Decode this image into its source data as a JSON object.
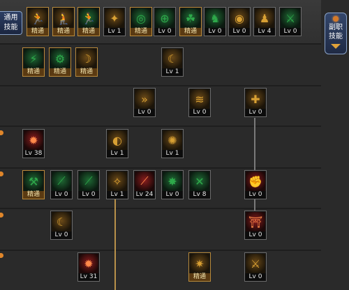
{
  "tabs": {
    "left_tab_label": "通用\n技能",
    "right_tab_label": "副职\n技能"
  },
  "colors": {
    "background": "#2a2a2a",
    "green_icon": "#2ea84a",
    "gold_icon": "#d8a033",
    "red_icon": "#c23030",
    "mastered_label": "#f4e6b0",
    "tree_line_gold": "#b8914a",
    "tree_line_gray": "#7a7a7a"
  },
  "skills": [
    {
      "name": "skill-1-1",
      "label": "精通",
      "glyph": "🏃",
      "theme": "gold",
      "mastered": true
    },
    {
      "name": "skill-1-2",
      "label": "精通",
      "glyph": "🧎",
      "theme": "gold",
      "mastered": true
    },
    {
      "name": "skill-1-3",
      "label": "精通",
      "glyph": "🏃",
      "theme": "green",
      "mastered": true
    },
    {
      "name": "skill-1-4",
      "label": "Lv 1",
      "glyph": "✦",
      "theme": "gold",
      "mastered": false
    },
    {
      "name": "skill-1-5",
      "label": "精通",
      "glyph": "◎",
      "theme": "green",
      "mastered": true
    },
    {
      "name": "skill-1-6",
      "label": "Lv 0",
      "glyph": "⊕",
      "theme": "green",
      "mastered": false
    },
    {
      "name": "skill-1-7",
      "label": "精通",
      "glyph": "☘",
      "theme": "green",
      "mastered": true
    },
    {
      "name": "skill-1-8",
      "label": "Lv 0",
      "glyph": "♞",
      "theme": "green",
      "mastered": false
    },
    {
      "name": "skill-1-9",
      "label": "Lv 0",
      "glyph": "◉",
      "theme": "gold",
      "mastered": false
    },
    {
      "name": "skill-1-10",
      "label": "Lv 4",
      "glyph": "♟",
      "theme": "gold",
      "mastered": false
    },
    {
      "name": "skill-1-11",
      "label": "Lv 0",
      "glyph": "⚔",
      "theme": "green",
      "mastered": false
    },
    {
      "name": "skill-2-1",
      "label": "精通",
      "glyph": "⚡",
      "theme": "green",
      "mastered": true
    },
    {
      "name": "skill-2-2",
      "label": "精通",
      "glyph": "⚙",
      "theme": "green",
      "mastered": true
    },
    {
      "name": "skill-2-3",
      "label": "精通",
      "glyph": "☽",
      "theme": "gold",
      "mastered": true
    },
    {
      "name": "skill-2-4",
      "label": "Lv 1",
      "glyph": "☾",
      "theme": "gold",
      "mastered": false
    },
    {
      "name": "skill-3-1",
      "label": "Lv 0",
      "glyph": "»",
      "theme": "gold",
      "mastered": false
    },
    {
      "name": "skill-3-2",
      "label": "Lv 0",
      "glyph": "≋",
      "theme": "gold",
      "mastered": false
    },
    {
      "name": "skill-3-3",
      "label": "Lv 0",
      "glyph": "✚",
      "theme": "gold",
      "mastered": false
    },
    {
      "name": "skill-4-1",
      "label": "Lv 38",
      "glyph": "✹",
      "theme": "red",
      "mastered": false
    },
    {
      "name": "skill-4-2",
      "label": "Lv 1",
      "glyph": "◐",
      "theme": "gold",
      "mastered": false
    },
    {
      "name": "skill-4-3",
      "label": "Lv 1",
      "glyph": "✺",
      "theme": "gold",
      "mastered": false
    },
    {
      "name": "skill-5-1",
      "label": "精通",
      "glyph": "⚒",
      "theme": "green",
      "mastered": true
    },
    {
      "name": "skill-5-2",
      "label": "Lv 0",
      "glyph": "⟋",
      "theme": "green",
      "mastered": false
    },
    {
      "name": "skill-5-3",
      "label": "Lv 0",
      "glyph": "⟋",
      "theme": "green",
      "mastered": false
    },
    {
      "name": "skill-5-4",
      "label": "Lv 1",
      "glyph": "✧",
      "theme": "gold",
      "mastered": false
    },
    {
      "name": "skill-5-5",
      "label": "Lv 24",
      "glyph": "⟋",
      "theme": "red",
      "mastered": false
    },
    {
      "name": "skill-5-6",
      "label": "Lv 0",
      "glyph": "✸",
      "theme": "green",
      "mastered": false
    },
    {
      "name": "skill-5-7",
      "label": "Lv 8",
      "glyph": "✕",
      "theme": "green",
      "mastered": false
    },
    {
      "name": "skill-5-8",
      "label": "Lv 0",
      "glyph": "✊",
      "theme": "red",
      "mastered": false
    },
    {
      "name": "skill-6-1",
      "label": "Lv 0",
      "glyph": "☾",
      "theme": "gold",
      "mastered": false
    },
    {
      "name": "skill-6-2",
      "label": "Lv 0",
      "glyph": "⛩",
      "theme": "red",
      "mastered": false
    },
    {
      "name": "skill-7-1",
      "label": "Lv 31",
      "glyph": "✹",
      "theme": "red",
      "mastered": false
    },
    {
      "name": "skill-7-2",
      "label": "精通",
      "glyph": "✷",
      "theme": "gold",
      "mastered": true
    },
    {
      "name": "skill-7-3",
      "label": "Lv 0",
      "glyph": "⚔",
      "theme": "gold",
      "mastered": false
    }
  ]
}
